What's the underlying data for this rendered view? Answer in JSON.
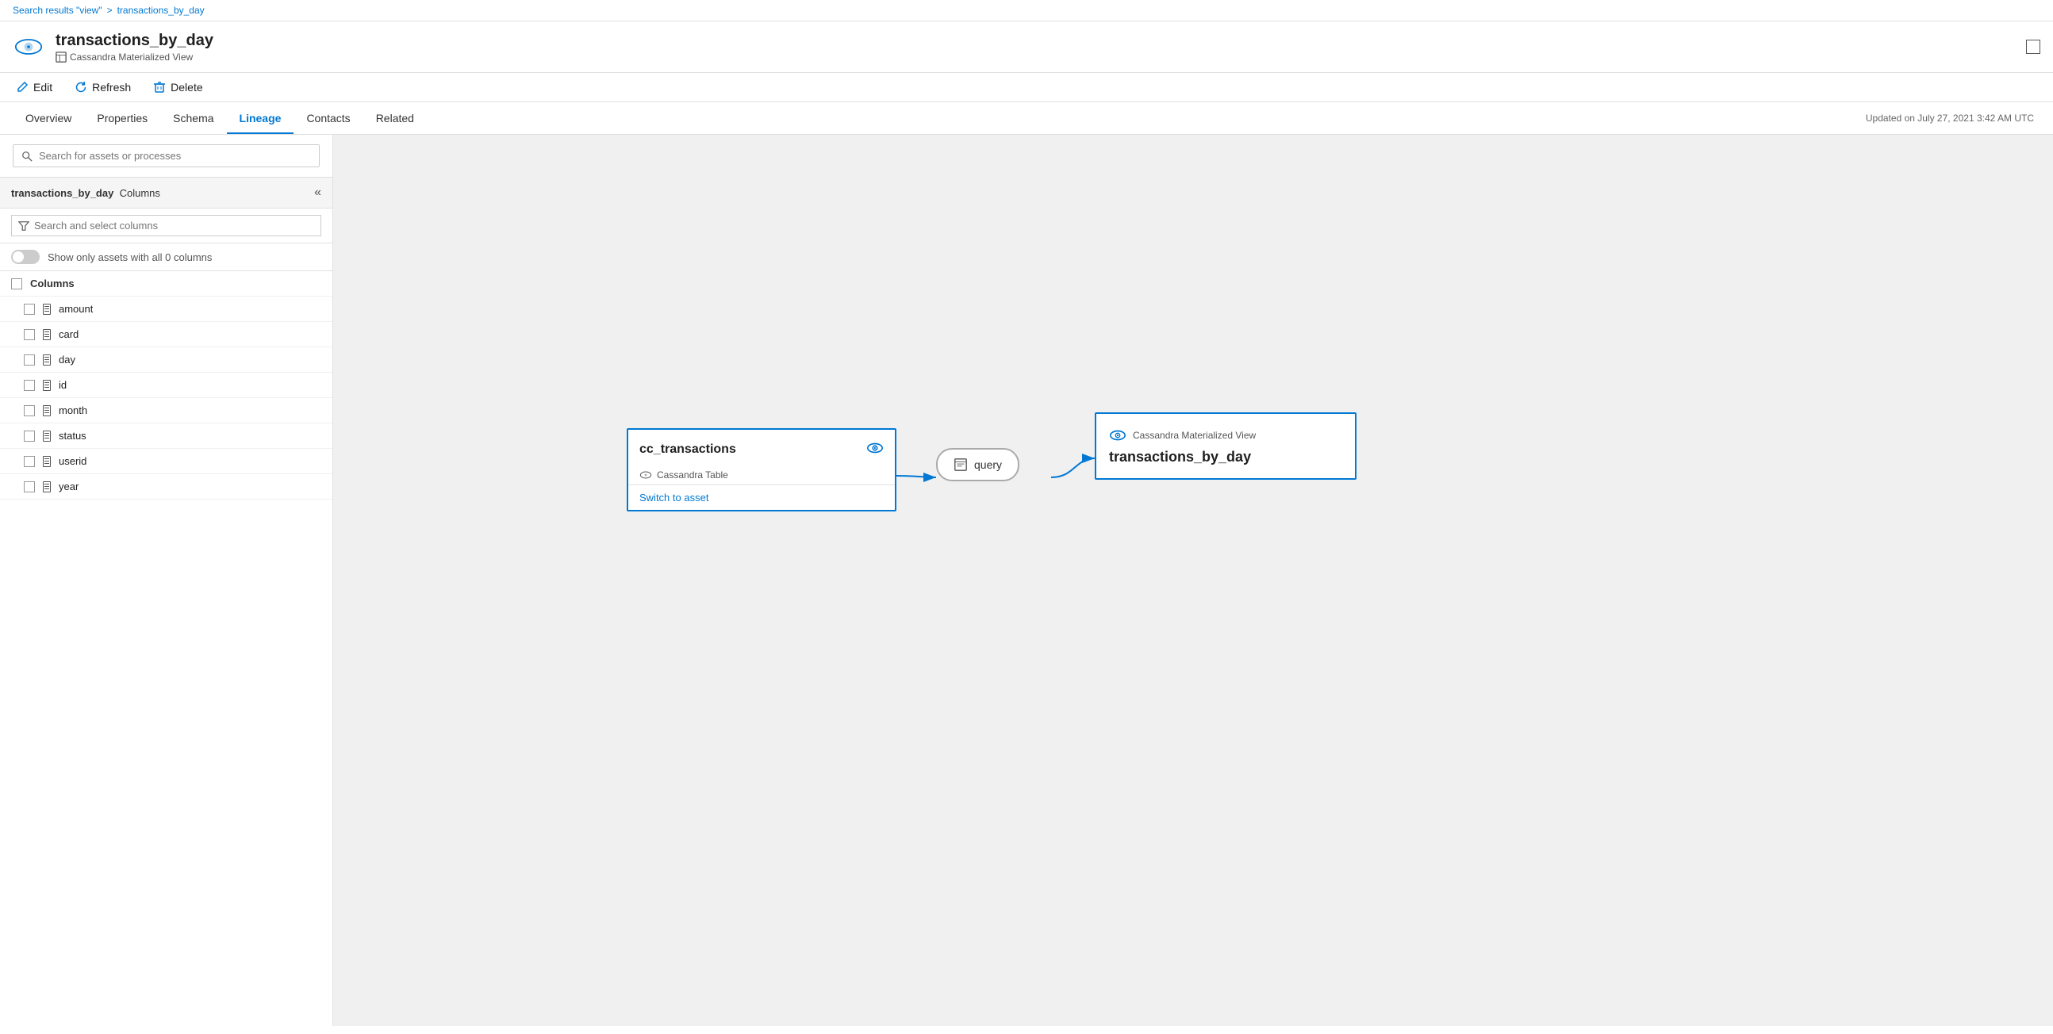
{
  "breadcrumb": {
    "link_label": "Search results \"view\"",
    "separator": ">",
    "current": "transactions_by_day"
  },
  "header": {
    "title": "transactions_by_day",
    "subtitle": "Cassandra Materialized View",
    "subtitle_icon": "table-icon"
  },
  "toolbar": {
    "edit_label": "Edit",
    "refresh_label": "Refresh",
    "delete_label": "Delete"
  },
  "tabs": [
    {
      "id": "overview",
      "label": "Overview",
      "active": false
    },
    {
      "id": "properties",
      "label": "Properties",
      "active": false
    },
    {
      "id": "schema",
      "label": "Schema",
      "active": false
    },
    {
      "id": "lineage",
      "label": "Lineage",
      "active": true
    },
    {
      "id": "contacts",
      "label": "Contacts",
      "active": false
    },
    {
      "id": "related",
      "label": "Related",
      "active": false
    }
  ],
  "tab_updated": "Updated on July 27, 2021 3:42 AM UTC",
  "lineage": {
    "search_placeholder": "Search for assets or processes",
    "panel": {
      "title_asset": "transactions_by_day",
      "title_suffix": "Columns",
      "collapse_label": "«",
      "column_search_placeholder": "Search and select columns",
      "toggle_label": "Show only assets with all 0 columns",
      "columns_header": "Columns",
      "columns": [
        {
          "name": "amount"
        },
        {
          "name": "card"
        },
        {
          "name": "day"
        },
        {
          "name": "id"
        },
        {
          "name": "month"
        },
        {
          "name": "status"
        },
        {
          "name": "userid"
        },
        {
          "name": "year"
        }
      ]
    },
    "source_node": {
      "title": "cc_transactions",
      "subtitle": "Cassandra Table",
      "footer": "Switch to asset"
    },
    "process_node": {
      "label": "query"
    },
    "target_node": {
      "subtitle": "Cassandra Materialized View",
      "title": "transactions_by_day"
    }
  }
}
